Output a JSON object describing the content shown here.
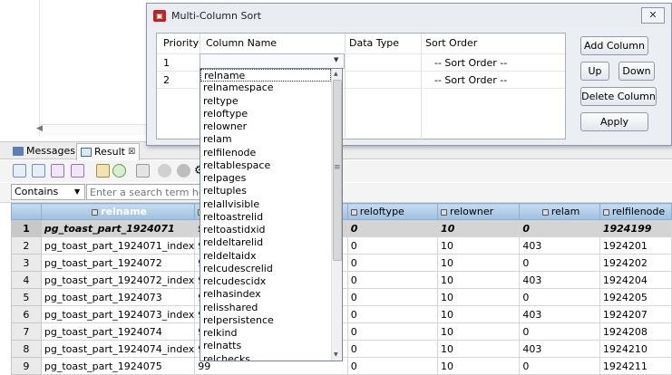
{
  "dialog": {
    "title": "Multi-Column Sort",
    "close_glyph": "✕",
    "grid": {
      "headers": [
        "Priority",
        "Column Name",
        "Data Type",
        "Sort Order"
      ],
      "rows": [
        {
          "priority": "1",
          "sort_order": "-- Sort Order --"
        },
        {
          "priority": "2",
          "sort_order": "-- Sort Order --"
        }
      ]
    },
    "buttons": {
      "add_column": "Add Column",
      "up": "Up",
      "down": "Down",
      "delete_column": "Delete Column",
      "apply": "Apply"
    }
  },
  "column_list": {
    "items": [
      "relname",
      "relnamespace",
      "reltype",
      "reloftype",
      "relowner",
      "relam",
      "relfilenode",
      "reltablespace",
      "relpages",
      "reltuples",
      "relallvisible",
      "reltoastrelid",
      "reltoastidxid",
      "reldeltarelid",
      "reldeltaidx",
      "relcudescrelid",
      "relcudescidx",
      "relhasindex",
      "relisshared",
      "relpersistence",
      "relkind",
      "relnatts",
      "relchecks"
    ],
    "highlighted": "relname"
  },
  "panel": {
    "tabs": [
      {
        "label": "Messages"
      },
      {
        "label": "Result",
        "close": "☒"
      }
    ],
    "filter_select": "Contains",
    "search_placeholder": "Enter a search term here"
  },
  "table": {
    "headers": [
      "relname",
      "relr",
      "",
      "reloftype",
      "relowner",
      "relam",
      "relfilenode"
    ],
    "rows": [
      {
        "n": "1",
        "relname": "pg_toast_part_1924071",
        "relnamespace": "99",
        "reloftype": "0",
        "relowner": "10",
        "relam": "0",
        "relfilenode": "1924199"
      },
      {
        "n": "2",
        "relname": "pg_toast_part_1924071_index",
        "relnamespace": "99",
        "reloftype": "0",
        "relowner": "10",
        "relam": "403",
        "relfilenode": "1924201"
      },
      {
        "n": "3",
        "relname": "pg_toast_part_1924072",
        "relnamespace": "99",
        "reloftype": "0",
        "relowner": "10",
        "relam": "0",
        "relfilenode": "1924202"
      },
      {
        "n": "4",
        "relname": "pg_toast_part_1924072_index",
        "relnamespace": "99",
        "reloftype": "0",
        "relowner": "10",
        "relam": "403",
        "relfilenode": "1924204"
      },
      {
        "n": "5",
        "relname": "pg_toast_part_1924073",
        "relnamespace": "99",
        "reloftype": "0",
        "relowner": "10",
        "relam": "0",
        "relfilenode": "1924205"
      },
      {
        "n": "6",
        "relname": "pg_toast_part_1924073_index",
        "relnamespace": "99",
        "reloftype": "0",
        "relowner": "10",
        "relam": "403",
        "relfilenode": "1924207"
      },
      {
        "n": "7",
        "relname": "pg_toast_part_1924074",
        "relnamespace": "99",
        "reloftype": "0",
        "relowner": "10",
        "relam": "0",
        "relfilenode": "1924208"
      },
      {
        "n": "8",
        "relname": "pg_toast_part_1924074_index",
        "relnamespace": "99",
        "reloftype": "0",
        "relowner": "10",
        "relam": "403",
        "relfilenode": "1924210"
      },
      {
        "n": "9",
        "relname": "pg_toast_part_1924075",
        "relnamespace": "99",
        "reloftype": "0",
        "relowner": "10",
        "relam": "0",
        "relfilenode": "1924211"
      }
    ]
  },
  "colors": {
    "header_blue": "#9dc0e2",
    "dialog_bg": "#ebeef3",
    "dialog_icon": "#c41e1e"
  }
}
